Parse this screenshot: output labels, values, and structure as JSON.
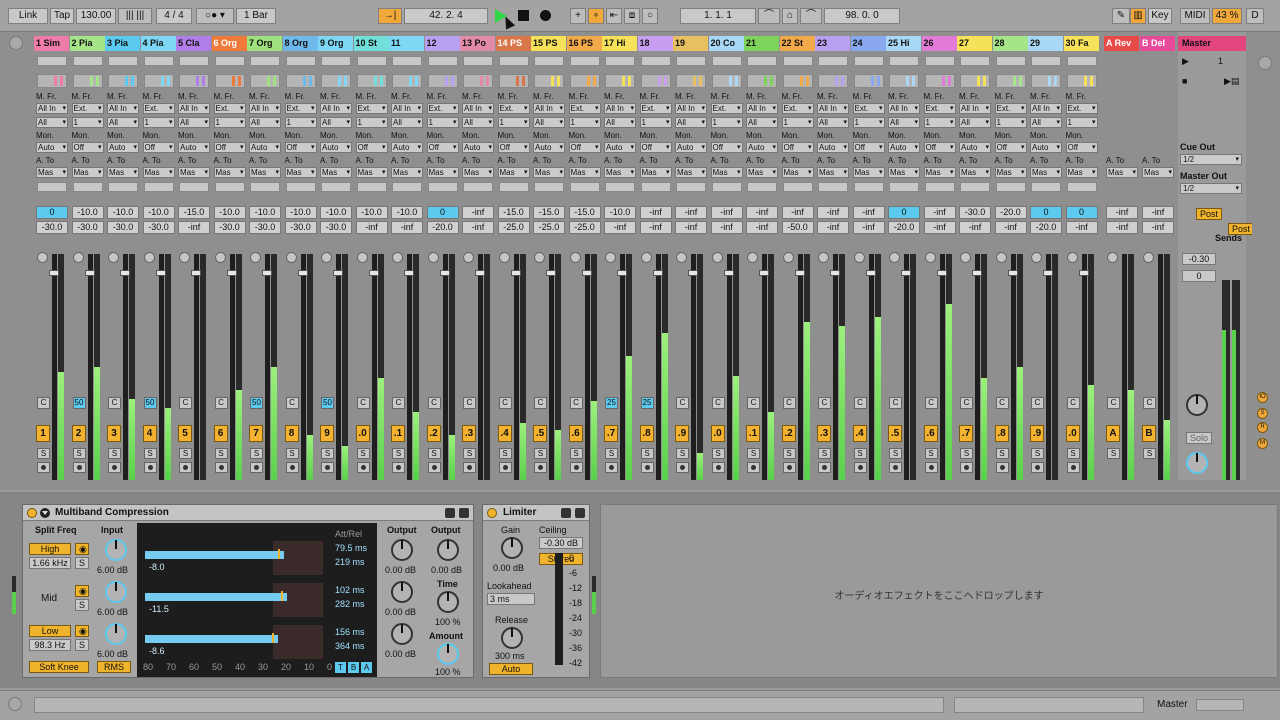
{
  "transport": {
    "link": "Link",
    "tap": "Tap",
    "tempo": "130.00",
    "signature": "4 / 4",
    "quantize": "1 Bar",
    "position": "42.  2.  4",
    "loop_start": "1.  1.  1",
    "loop_length": "98.  0.  0",
    "key": "Key",
    "midi": "MIDI",
    "cpu": "43 %",
    "disk": "D"
  },
  "tracks": [
    {
      "name": "1 Sim",
      "color": "#ef7ba8",
      "vol": "0",
      "pan": "-30.0",
      "vol_hi": true,
      "cue": "C",
      "arm": "1",
      "fill": 0.48
    },
    {
      "name": "2 Pia",
      "color": "#a6e48a",
      "vol": "-10.0",
      "pan": "-30.0",
      "cue": "50",
      "cue_hi": true,
      "arm": "2",
      "fill": 0.5
    },
    {
      "name": "3 Pia",
      "color": "#5cc9ee",
      "vol": "-10.0",
      "pan": "-30.0",
      "cue": "C",
      "arm": "3",
      "fill": 0.36
    },
    {
      "name": "4 Pia",
      "color": "#7ed8f5",
      "vol": "-10.0",
      "pan": "-30.0",
      "cue": "50",
      "cue_hi": true,
      "arm": "4",
      "fill": 0.32
    },
    {
      "name": "5 Cla",
      "color": "#b07ee8",
      "vol": "-15.0",
      "pan": "-inf",
      "cue": "C",
      "arm": "5",
      "fill": 0.0
    },
    {
      "name": "6 Org",
      "color": "#ef7a3a",
      "vol": "-10.0",
      "pan": "-30.0",
      "cue": "C",
      "arm": "6",
      "fill": 0.4
    },
    {
      "name": "7 Org",
      "color": "#9fe07f",
      "vol": "-10.0",
      "pan": "-30.0",
      "cue": "50",
      "cue_hi": true,
      "arm": "7",
      "fill": 0.5
    },
    {
      "name": "8 Org",
      "color": "#6fb8ea",
      "vol": "-10.0",
      "pan": "-30.0",
      "cue": "C",
      "arm": "8",
      "fill": 0.2
    },
    {
      "name": "9 Org",
      "color": "#7ed8f5",
      "vol": "-10.0",
      "pan": "-30.0",
      "cue": "50",
      "cue_hi": true,
      "arm": "9",
      "fill": 0.15
    },
    {
      "name": "10 St",
      "color": "#72e0d9",
      "vol": "-10.0",
      "pan": "-inf",
      "cue": "C",
      "arm": ".0",
      "fill": 0.45
    },
    {
      "name": "11",
      "color": "#7ed8f5",
      "vol": "-10.0",
      "pan": "-inf",
      "cue": "C",
      "arm": ".1",
      "fill": 0.3
    },
    {
      "name": "12",
      "color": "#b8a0f0",
      "vol": "0",
      "pan": "-20.0",
      "vol_hi": true,
      "cue": "C",
      "arm": ".2",
      "fill": 0.2
    },
    {
      "name": "13 Po",
      "color": "#e38aa8",
      "vol": "-inf",
      "pan": "-inf",
      "cue": "C",
      "arm": ".3",
      "fill": 0.0
    },
    {
      "name": "14 PS",
      "color": "#d9774a",
      "vol": "-15.0",
      "pan": "-25.0",
      "cue": "C",
      "arm": ".4",
      "fill": 0.25
    },
    {
      "name": "15 PS",
      "color": "#f5e25a",
      "vol": "-15.0",
      "pan": "-25.0",
      "cue": "C",
      "arm": ".5",
      "fill": 0.22
    },
    {
      "name": "16 PS",
      "color": "#f2a94a",
      "vol": "-15.0",
      "pan": "-25.0",
      "cue": "C",
      "arm": ".6",
      "fill": 0.35
    },
    {
      "name": "17 Hi",
      "color": "#f5e25a",
      "vol": "-10.0",
      "pan": "-inf",
      "cue": "25",
      "cue_hi": true,
      "arm": ".7",
      "fill": 0.55
    },
    {
      "name": "18",
      "color": "#c89ef0",
      "vol": "-inf",
      "pan": "-inf",
      "cue": "25",
      "cue_hi": true,
      "arm": ".8",
      "fill": 0.65
    },
    {
      "name": "19",
      "color": "#e8c062",
      "vol": "-inf",
      "pan": "-inf",
      "cue": "C",
      "arm": ".9",
      "fill": 0.12
    },
    {
      "name": "20 Co",
      "color": "#a8d8f5",
      "vol": "-inf",
      "pan": "-inf",
      "cue": "C",
      "arm": ".0",
      "fill": 0.46
    },
    {
      "name": "21",
      "color": "#7ed45a",
      "vol": "-inf",
      "pan": "-inf",
      "cue": "C",
      "arm": ".1",
      "fill": 0.3
    },
    {
      "name": "22 St",
      "color": "#f2a94a",
      "vol": "-inf",
      "pan": "-50.0",
      "cue": "C",
      "arm": ".2",
      "fill": 0.7
    },
    {
      "name": "23",
      "color": "#b8a0f0",
      "vol": "-inf",
      "pan": "-inf",
      "cue": "C",
      "arm": ".3",
      "fill": 0.68
    },
    {
      "name": "24",
      "color": "#8aa8f0",
      "vol": "-inf",
      "pan": "-inf",
      "cue": "C",
      "arm": ".4",
      "fill": 0.72
    },
    {
      "name": "25 Hi",
      "color": "#a8d8f5",
      "vol": "0",
      "pan": "-20.0",
      "vol_hi": true,
      "cue": "C",
      "arm": ".5",
      "fill": 0.0
    },
    {
      "name": "26",
      "color": "#e27ad8",
      "vol": "-inf",
      "pan": "-inf",
      "cue": "C",
      "arm": ".6",
      "fill": 0.78
    },
    {
      "name": "27",
      "color": "#f5e25a",
      "vol": "-30.0",
      "pan": "-inf",
      "cue": "C",
      "arm": ".7",
      "fill": 0.45
    },
    {
      "name": "28",
      "color": "#a6e48a",
      "vol": "-20.0",
      "pan": "-inf",
      "cue": "C",
      "arm": ".8",
      "fill": 0.5
    },
    {
      "name": "29",
      "color": "#a8d8f5",
      "vol": "0",
      "pan": "-20.0",
      "vol_hi": true,
      "cue": "C",
      "arm": ".9",
      "fill": 0.0
    },
    {
      "name": "30 Fa",
      "color": "#f5e25a",
      "vol": "0",
      "pan": "-inf",
      "vol_hi": true,
      "cue": "C",
      "arm": ".0",
      "fill": 0.42
    }
  ],
  "strip_labels": {
    "monitor_from": "M. Fr.",
    "all_ins": "All In",
    "ext": "Ext.",
    "all": "All",
    "one": "1",
    "off": "Off",
    "mon": "Mon.",
    "auto": "Auto",
    "audio_to": "A. To",
    "master": "Mas"
  },
  "returns": [
    {
      "name": "A Rev",
      "color": "#e84a4a",
      "vol": "-inf",
      "pan": "-inf",
      "cue": "C",
      "arm": "A"
    },
    {
      "name": "B Del",
      "color": "#e84a9a",
      "vol": "-inf",
      "pan": "-inf",
      "cue": "C",
      "arm": "B"
    }
  ],
  "master": {
    "name": "Master",
    "scene_number": "1",
    "cue_out_label": "Cue Out",
    "cue_out_value": "1/2",
    "master_out_label": "Master Out",
    "master_out_value": "1/2",
    "sends_label": "Sends",
    "post_label": "Post",
    "volume": "-0.30",
    "pan": "0",
    "solo_label": "Solo",
    "fill": 0.75
  },
  "devices": {
    "multiband": {
      "title": "Multiband Compression",
      "split_freq": "Split Freq",
      "input": "Input",
      "att_rel": "Att/Rel",
      "output": "Output",
      "output2": "Output",
      "time": "Time",
      "amount": "Amount",
      "high": "High",
      "high_freq": "1.66 kHz",
      "mid": "Mid",
      "low": "Low",
      "low_freq": "98.3 Hz",
      "soft_knee": "Soft Knee",
      "rms": "RMS",
      "s_label": "S",
      "in_gain_high": "6.00 dB",
      "in_gain_mid": "6.00 dB",
      "in_gain_low": "6.00 dB",
      "out_high": "0.00 dB",
      "out_mid": "0.00 dB",
      "out_low": "0.00 dB",
      "out_master": "0.00 dB",
      "time_value": "100 %",
      "amount_value": "100 %",
      "bands": [
        {
          "gr": "-8.0",
          "att": "79.5 ms",
          "rel": "219 ms",
          "level": 0.77
        },
        {
          "gr": "-11.5",
          "att": "102 ms",
          "rel": "282 ms",
          "level": 0.79
        },
        {
          "gr": "-8.6",
          "att": "156 ms",
          "rel": "364 ms",
          "level": 0.74
        }
      ],
      "axis": [
        "80",
        "70",
        "60",
        "50",
        "40",
        "30",
        "20",
        "10",
        "0"
      ],
      "tba": [
        "T",
        "B",
        "A"
      ]
    },
    "limiter": {
      "title": "Limiter",
      "gain": "Gain",
      "gain_value": "0.00 dB",
      "ceiling": "Ceiling",
      "ceiling_value": "-0.30 dB",
      "stereo": "Stereo",
      "lookahead": "Lookahead",
      "lookahead_value": "3 ms",
      "release": "Release",
      "release_value": "300 ms",
      "auto": "Auto",
      "scale": [
        "0",
        "-6",
        "-12",
        "-18",
        "-24",
        "-30",
        "-36",
        "-42"
      ]
    },
    "drop_hint": "オーディオエフェクトをここへドロップします"
  },
  "status": {
    "track_name": "Master"
  },
  "icons": {
    "play": "play-icon",
    "stop": "stop-icon",
    "record": "record-icon",
    "metronome": "metronome-icon",
    "pencil": "pencil-icon",
    "keyboard": "keyboard-icon"
  }
}
